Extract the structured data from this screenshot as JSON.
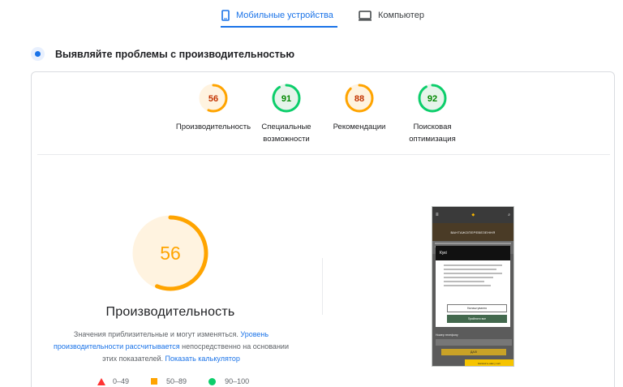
{
  "tabs": {
    "mobile": {
      "label": "Мобильные устройства",
      "active": true
    },
    "desktop": {
      "label": "Компьютер",
      "active": false
    }
  },
  "section": {
    "title": "Выявляйте проблемы с производительностью"
  },
  "gauges": [
    {
      "value": "56",
      "label_line1": "Производительность",
      "label_line2": "",
      "score": 56,
      "color": "#ffa400",
      "text_color": "#c33300",
      "bg": "#fff3e0"
    },
    {
      "value": "91",
      "label_line1": "Специальные",
      "label_line2": "возможности",
      "score": 91,
      "color": "#0cce6b",
      "text_color": "#008800",
      "bg": "#e6f4ea"
    },
    {
      "value": "88",
      "label_line1": "Рекомендации",
      "label_line2": "",
      "score": 88,
      "color": "#ffa400",
      "text_color": "#c33300",
      "bg": "#fff3e0"
    },
    {
      "value": "92",
      "label_line1": "Поисковая",
      "label_line2": "оптимизация",
      "score": 92,
      "color": "#0cce6b",
      "text_color": "#008800",
      "bg": "#e6f4ea"
    }
  ],
  "performance": {
    "score": 56,
    "value": "56",
    "title": "Производительность",
    "color": "#ffa400",
    "desc_part1": "Значения приблизительные и могут изменяться. ",
    "desc_link1": "Уровень производительности рассчитывается",
    "desc_part2": " непосредственно на основании этих показателей. ",
    "desc_link2": "Показать калькулятор"
  },
  "legend": {
    "poor": "0–49",
    "average": "50–89",
    "good": "90–100"
  },
  "screenshot": {
    "site_banner": "ВАНТАЖОПЕРЕВЕЗЕННЯ",
    "modal_title": "Кукі",
    "btn_outline": "Налаштування",
    "btn_fill": "Прийняти все",
    "field_label": "Номер телефону",
    "gold_button": "ДАЛІ",
    "chat_label": "Напишіть нам у чаті"
  }
}
